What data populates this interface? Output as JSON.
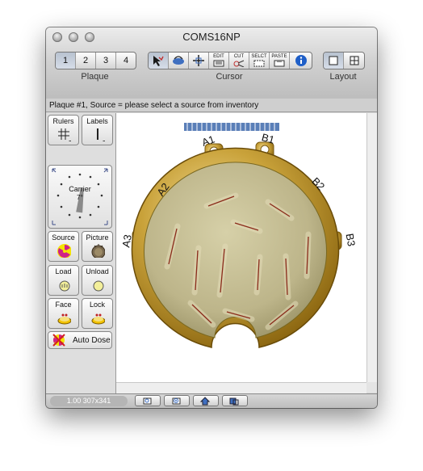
{
  "window": {
    "title": "COMS16NP"
  },
  "toolbar": {
    "plaque": {
      "label": "Plaque",
      "buttons": [
        "1",
        "2",
        "3",
        "4"
      ],
      "selected": "1"
    },
    "cursor": {
      "label": "Cursor",
      "tools": [
        "select-target-icon",
        "rotate-hand-icon",
        "move-cross-icon",
        "edit-icon",
        "cut-icon",
        "select-icon",
        "paste-icon",
        "info-icon"
      ],
      "edit_label": "EDIT",
      "cut_label": "CUT",
      "select_label": "SELCT",
      "paste_label": "PASTE",
      "info_color": "#1f5fc8"
    },
    "layout": {
      "label": "Layout",
      "buttons": [
        "single-view-icon",
        "quad-view-icon"
      ]
    }
  },
  "status": {
    "text": "Plaque #1, Source = please select a source from inventory"
  },
  "panel": {
    "rulers_label": "Rulers",
    "labels_label": "Labels",
    "carrier": {
      "label": "Carrier",
      "angle": "7°"
    },
    "source_label": "Source",
    "picture_label": "Picture",
    "load_label": "Load",
    "unload_label": "Unload",
    "face_label": "Face",
    "lock_label": "Lock",
    "autodose_label": "Auto Dose"
  },
  "plaque_view": {
    "eyelet_labels": [
      "A1",
      "B1",
      "A2",
      "B2",
      "A3",
      "B3"
    ],
    "colors": {
      "gold": "#b8922a",
      "inner": "#c9c297",
      "seed": "#8a2a1a"
    }
  },
  "bottom": {
    "zoom_text": "1.00 307x341"
  }
}
